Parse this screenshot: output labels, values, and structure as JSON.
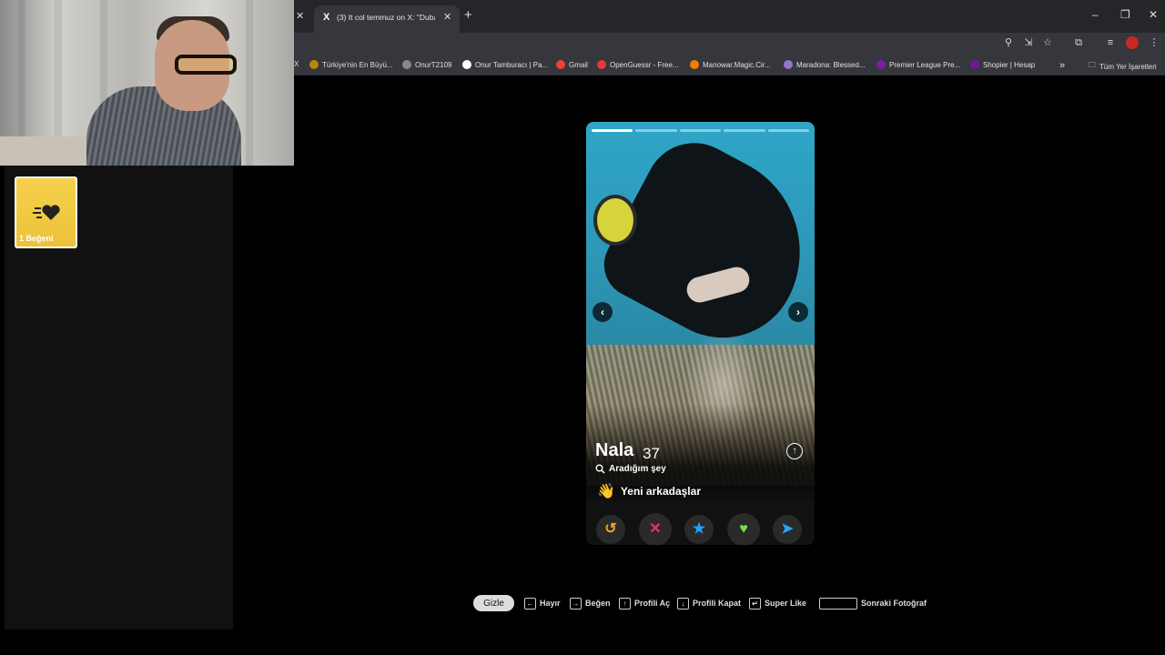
{
  "browser": {
    "tab_title": "(3) It col temmuz on X: \"Dubai",
    "tab_favicon": "X"
  },
  "bookmarks": [
    {
      "label": "Türkiye'nin En Büyü...",
      "icon": "globe-icon",
      "color": "#b8860b"
    },
    {
      "label": "OnurT2109",
      "icon": "globe-icon",
      "color": "#888888"
    },
    {
      "label": "Onur Tamburacı | Pa...",
      "icon": "patreon-icon",
      "color": "#ffffff"
    },
    {
      "label": "Gmail",
      "icon": "gmail-icon",
      "color": "#ea4335"
    },
    {
      "label": "OpenGuessr - Free...",
      "icon": "pin-icon",
      "color": "#e53935"
    },
    {
      "label": "Manowar.Magic.Cir...",
      "icon": "blogger-icon",
      "color": "#f57c00"
    },
    {
      "label": "Maradona: Blessed...",
      "icon": "letterboxd-icon",
      "color": "#9575cd"
    },
    {
      "label": "Premier League Pre...",
      "icon": "pl-icon",
      "color": "#7b1fa2"
    },
    {
      "label": "Shopier | Hesap",
      "icon": "shopier-icon",
      "color": "#6a1b9a"
    }
  ],
  "bookmarks_all": "Tüm Yer İşaretleri",
  "likes_card": {
    "label": "1 Beğeni",
    "icon": "likes-heart-icon"
  },
  "profile": {
    "name": "Nala",
    "age": "37",
    "looking_label": "Aradığım şey",
    "goal": "Yeni arkadaşlar",
    "photo_count": 5,
    "active_photo": 1
  },
  "actions": [
    {
      "name": "rewind",
      "glyph": "↺",
      "color": "#f5a623"
    },
    {
      "name": "nope",
      "glyph": "✕",
      "color": "#fd267d"
    },
    {
      "name": "super-like",
      "glyph": "★",
      "color": "#1ea4ff"
    },
    {
      "name": "like",
      "glyph": "♥",
      "color": "#6fe34c"
    },
    {
      "name": "boost",
      "glyph": "➤",
      "color": "#28a5ff"
    }
  ],
  "shortcuts": {
    "hide": "Gizle",
    "nope": "Hayır",
    "like": "Beğen",
    "open_profile": "Profili Aç",
    "close_profile": "Profili Kapat",
    "super_like": "Super Like",
    "next_photo": "Sonraki Fotoğraf"
  }
}
